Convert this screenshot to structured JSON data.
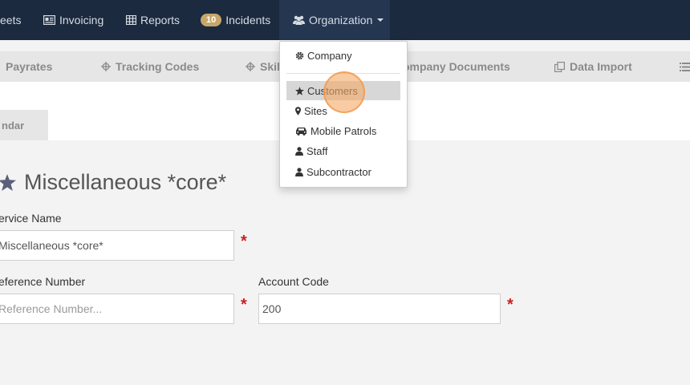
{
  "navbar": {
    "items": [
      {
        "label": "eets",
        "icon": "none"
      },
      {
        "label": "Invoicing",
        "icon": "invoice-icon"
      },
      {
        "label": "Reports",
        "icon": "table-icon"
      },
      {
        "label": "Incidents",
        "badge": "10"
      },
      {
        "label": "Organization",
        "icon": "users-icon",
        "active": true
      }
    ]
  },
  "subnav": {
    "items": [
      {
        "label": "Payrates"
      },
      {
        "label": "Tracking Codes",
        "icon": "crosshair-icon"
      },
      {
        "label": "Skil",
        "icon": "crosshair-icon"
      },
      {
        "label": "ompany Documents"
      },
      {
        "label": "Data Import",
        "icon": "copy-icon"
      }
    ]
  },
  "tab": {
    "label": "ndar"
  },
  "dropdown": {
    "items": [
      {
        "label": "Company",
        "icon": "gear-icon"
      },
      {
        "label": "Customers",
        "icon": "star-icon",
        "hover": true
      },
      {
        "label": "Sites",
        "icon": "map-marker-icon"
      },
      {
        "label": "Mobile Patrols",
        "icon": "car-icon"
      },
      {
        "label": "Staff",
        "icon": "user-icon"
      },
      {
        "label": "Subcontractor",
        "icon": "user-icon"
      }
    ]
  },
  "form": {
    "title": "Miscellaneous *core*",
    "service_name_label": "ervice Name",
    "service_name_value": "Miscellaneous *core*",
    "reference_label": "eference Number",
    "reference_placeholder": "Reference Number...",
    "account_code_label": "Account Code",
    "account_code_value": "200",
    "required_mark": "*"
  },
  "colors": {
    "navbar": "#1b2a3e",
    "badge": "#c7a66a",
    "required": "#cc1f1f",
    "title_icon": "#5a6079"
  }
}
